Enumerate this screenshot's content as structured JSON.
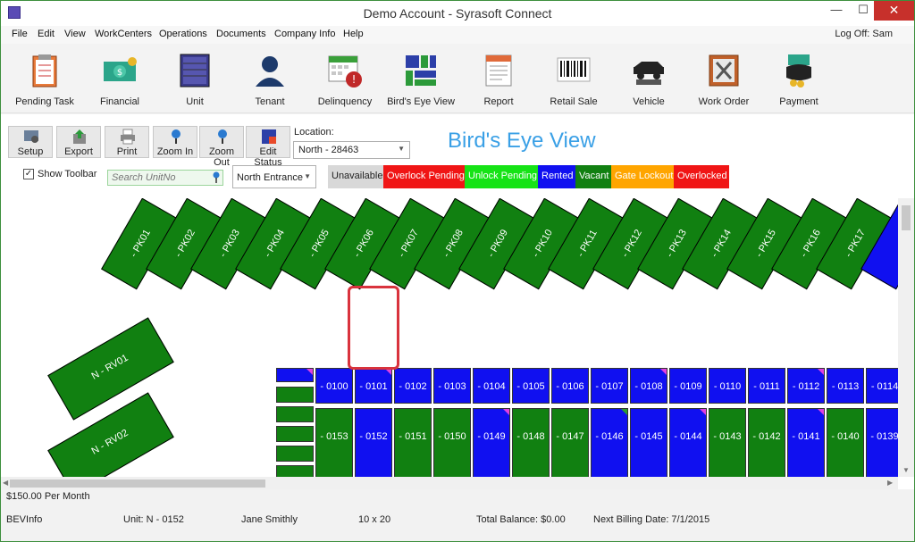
{
  "window": {
    "title": "Demo Account - Syrasoft Connect",
    "min_glyph": "—",
    "max_glyph": "☐",
    "close_glyph": "✕"
  },
  "menu": {
    "items": [
      "File",
      "Edit",
      "View",
      "WorkCenters",
      "Operations",
      "Documents",
      "Company Info",
      "Help"
    ],
    "logoff": "Log Off: Sam"
  },
  "toolbar": {
    "buttons": [
      "Pending Task",
      "Financial",
      "Unit",
      "Tenant",
      "Delinquency",
      "Bird's Eye View",
      "Report",
      "Retail Sale",
      "Vehicle",
      "Work Order",
      "Payment"
    ]
  },
  "bev_toolbar": {
    "buttons": [
      "Setup",
      "Export",
      "Print",
      "Zoom In",
      "Zoom Out",
      "Edit Status"
    ],
    "location_label": "Location:",
    "location_value": "North - 28463",
    "title": "Bird's Eye View",
    "show_toolbar_label": "Show Toolbar",
    "show_toolbar_checked": "✓",
    "search_placeholder": "Search UnitNo",
    "entrance_value": "North Entrance"
  },
  "legend": [
    {
      "label": "Unavailable",
      "color": "#d8d8d8"
    },
    {
      "label": "Overlock Pending",
      "color": "#f01515"
    },
    {
      "label": "Unlock Pending",
      "color": "#16e316"
    },
    {
      "label": "Rented",
      "color": "#1010f0"
    },
    {
      "label": "Vacant",
      "color": "#118011"
    },
    {
      "label": "Gate Lockout",
      "color": "#ffa500"
    },
    {
      "label": "Overlocked",
      "color": "#f01515"
    }
  ],
  "map": {
    "pk_units": [
      "- PK01",
      "- PK02",
      "- PK03",
      "- PK04",
      "- PK05",
      "- PK06",
      "- PK07",
      "- PK08",
      "- PK09",
      "- PK10",
      "- PK11",
      "- PK12",
      "- PK13",
      "- PK14",
      "- PK15",
      "- PK16",
      "- PK17"
    ],
    "rv_units": [
      "N - RV01",
      "N - RV02"
    ],
    "top_row": [
      {
        "label": "- 0100",
        "status": "rented"
      },
      {
        "label": "- 0101",
        "status": "rented"
      },
      {
        "label": "- 0102",
        "status": "rented"
      },
      {
        "label": "- 0103",
        "status": "rented"
      },
      {
        "label": "- 0104",
        "status": "rented"
      },
      {
        "label": "- 0105",
        "status": "rented"
      },
      {
        "label": "- 0106",
        "status": "rented"
      },
      {
        "label": "- 0107",
        "status": "rented"
      },
      {
        "label": "- 0108",
        "status": "rented"
      },
      {
        "label": "- 0109",
        "status": "rented"
      },
      {
        "label": "- 0110",
        "status": "rented"
      },
      {
        "label": "- 0111",
        "status": "rented"
      },
      {
        "label": "- 0112",
        "status": "rented"
      },
      {
        "label": "- 0113",
        "status": "rented"
      },
      {
        "label": "- 0114",
        "status": "rented"
      }
    ],
    "bottom_row": [
      {
        "label": "- 0153",
        "status": "vacant"
      },
      {
        "label": "- 0152",
        "status": "rented"
      },
      {
        "label": "- 0151",
        "status": "vacant"
      },
      {
        "label": "- 0150",
        "status": "vacant"
      },
      {
        "label": "- 0149",
        "status": "rented"
      },
      {
        "label": "- 0148",
        "status": "vacant"
      },
      {
        "label": "- 0147",
        "status": "vacant"
      },
      {
        "label": "- 0146",
        "status": "rented"
      },
      {
        "label": "- 0145",
        "status": "rented"
      },
      {
        "label": "- 0144",
        "status": "rented"
      },
      {
        "label": "- 0143",
        "status": "vacant"
      },
      {
        "label": "- 0142",
        "status": "vacant"
      },
      {
        "label": "- 0141",
        "status": "rented"
      },
      {
        "label": "- 0140",
        "status": "vacant"
      },
      {
        "label": "- 0139",
        "status": "rented"
      }
    ],
    "selected_unit": "- 0152"
  },
  "status": {
    "price": "$150.00 Per Month",
    "source": "BEVInfo",
    "unit": "Unit: N - 0152",
    "tenant": "Jane Smithly",
    "size": "10 x 20",
    "balance": "Total Balance: $0.00",
    "billing": "Next Billing Date: 7/1/2015"
  },
  "colors": {
    "rented": "#1010f0",
    "vacant": "#118011",
    "accent": "#3aa0e6"
  }
}
